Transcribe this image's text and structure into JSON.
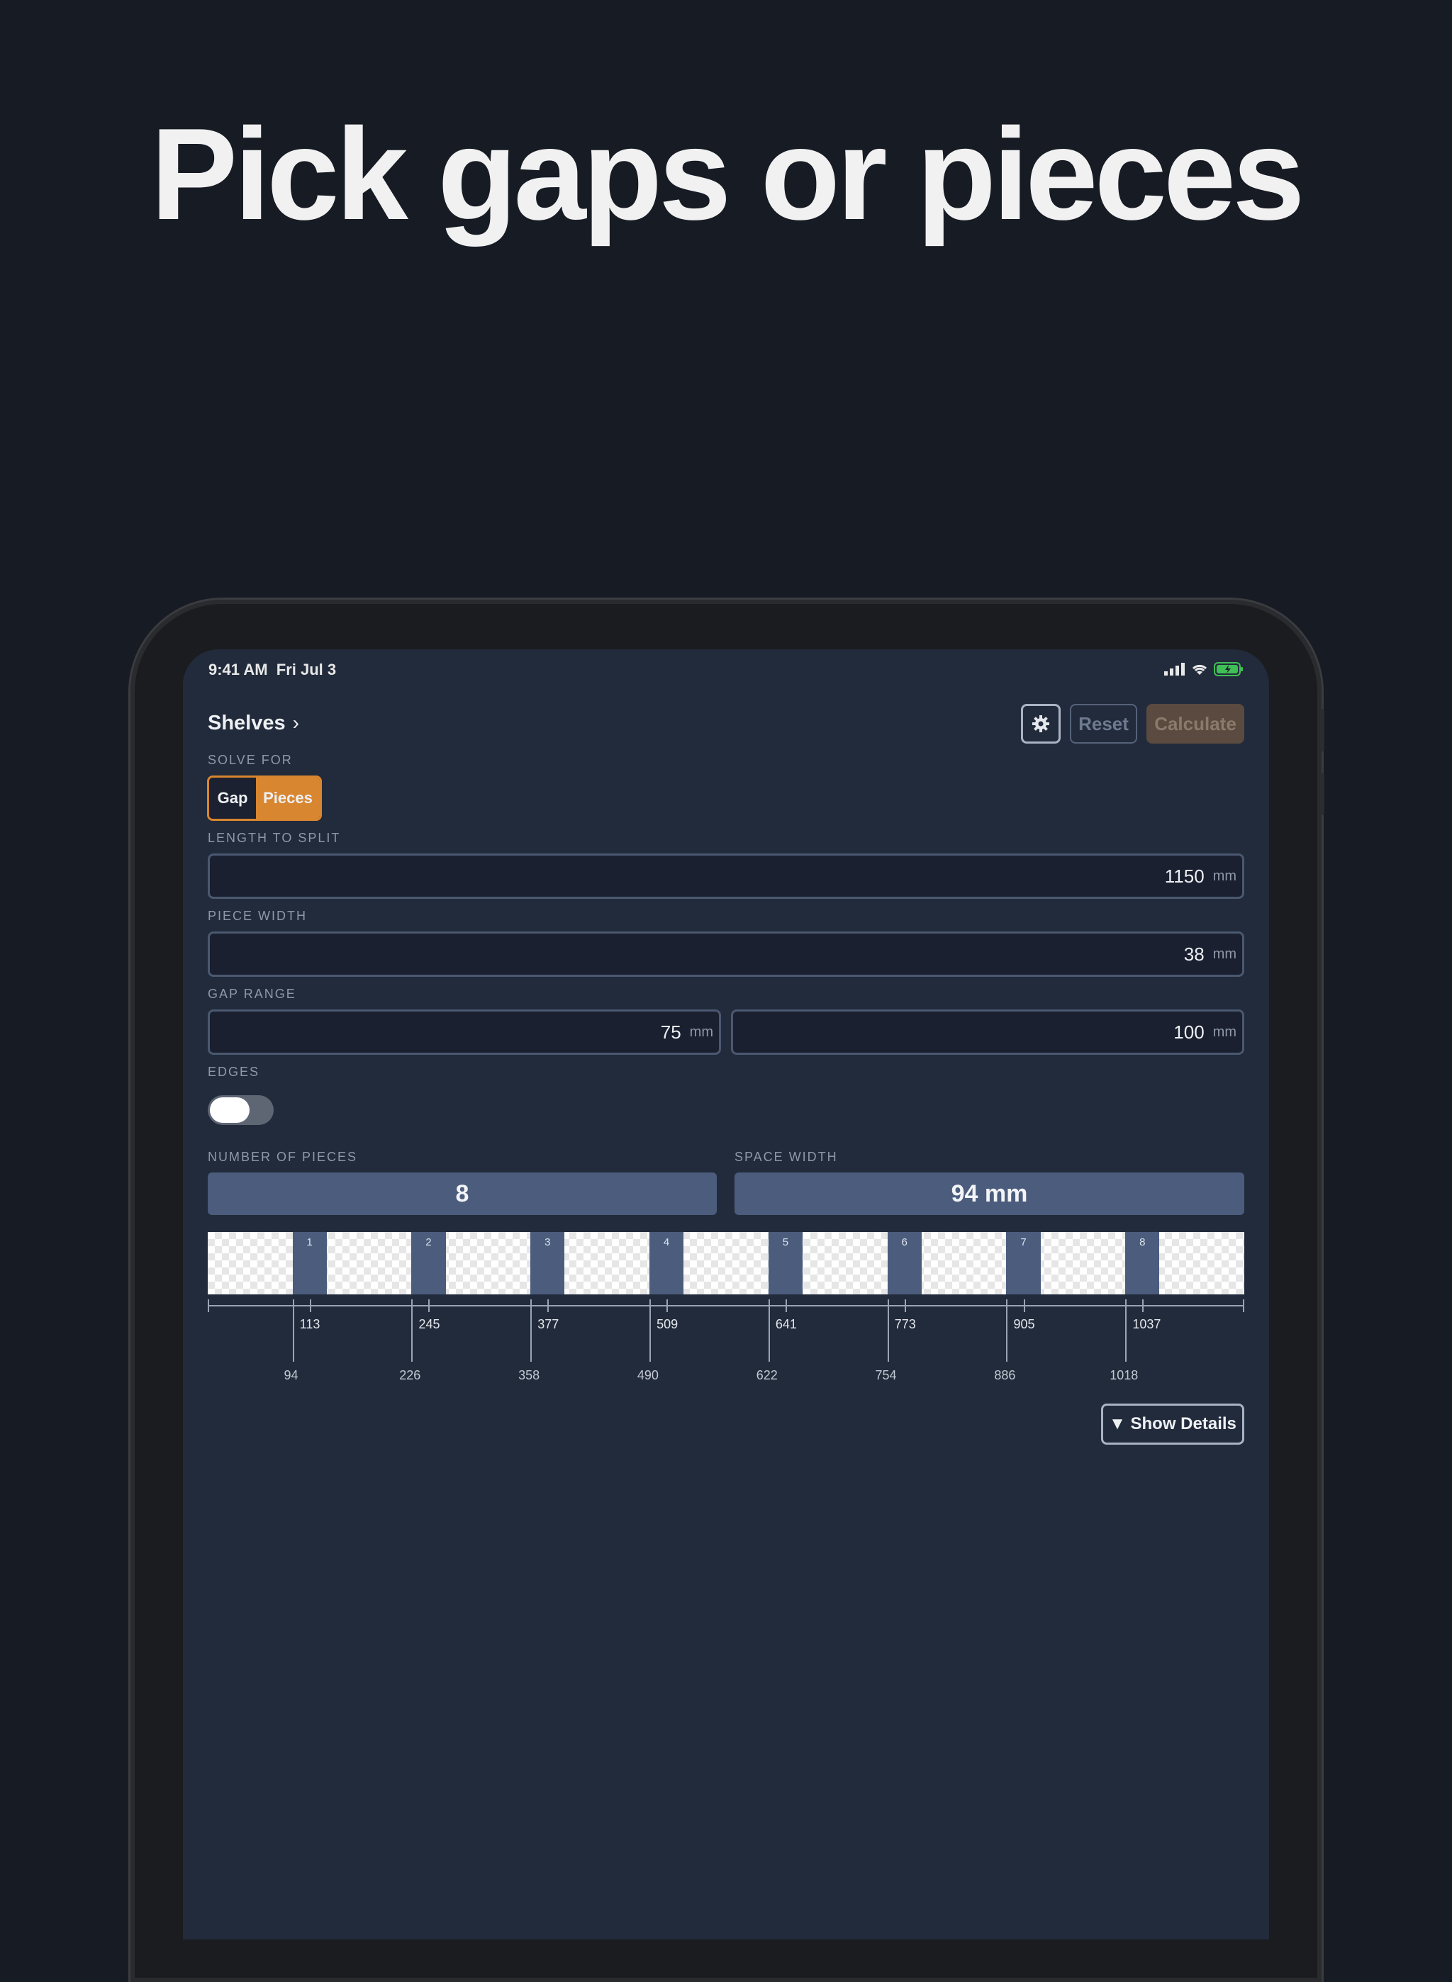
{
  "headline": "Pick gaps or pieces",
  "status": {
    "time": "9:41 AM",
    "date": "Fri Jul 3"
  },
  "header": {
    "title": "Shelves",
    "chevron": "›",
    "reset_label": "Reset",
    "calculate_label": "Calculate"
  },
  "solve_for": {
    "label": "SOLVE FOR",
    "options": [
      "Gap",
      "Pieces"
    ],
    "selected": "Pieces"
  },
  "length": {
    "label": "LENGTH TO SPLIT",
    "value": "1150",
    "unit": "mm"
  },
  "piece_width": {
    "label": "PIECE WIDTH",
    "value": "38",
    "unit": "mm"
  },
  "gap_range": {
    "label": "GAP RANGE",
    "min": "75",
    "max": "100",
    "unit": "mm"
  },
  "edges": {
    "label": "EDGES",
    "on": false
  },
  "results": {
    "pieces_label": "NUMBER OF PIECES",
    "pieces_value": "8",
    "space_label": "SPACE WIDTH",
    "space_value": "94 mm"
  },
  "layout": {
    "total_length": 1150,
    "piece_width": 38,
    "pieces": [
      "1",
      "2",
      "3",
      "4",
      "5",
      "6",
      "7",
      "8"
    ],
    "piece_starts": [
      94,
      226,
      358,
      490,
      622,
      754,
      886,
      1018
    ],
    "center_labels": [
      "113",
      "245",
      "377",
      "509",
      "641",
      "773",
      "905",
      "1037"
    ],
    "start_labels": [
      "94",
      "226",
      "358",
      "490",
      "622",
      "754",
      "886",
      "1018"
    ]
  },
  "details_button": "▼ Show Details",
  "icons": {
    "settings": "gear-icon",
    "signal": "signal-icon",
    "wifi": "wifi-icon",
    "battery": "battery-icon"
  },
  "colors": {
    "accent": "#d98630",
    "piece": "#4b5c7d",
    "background": "#222b3b"
  }
}
